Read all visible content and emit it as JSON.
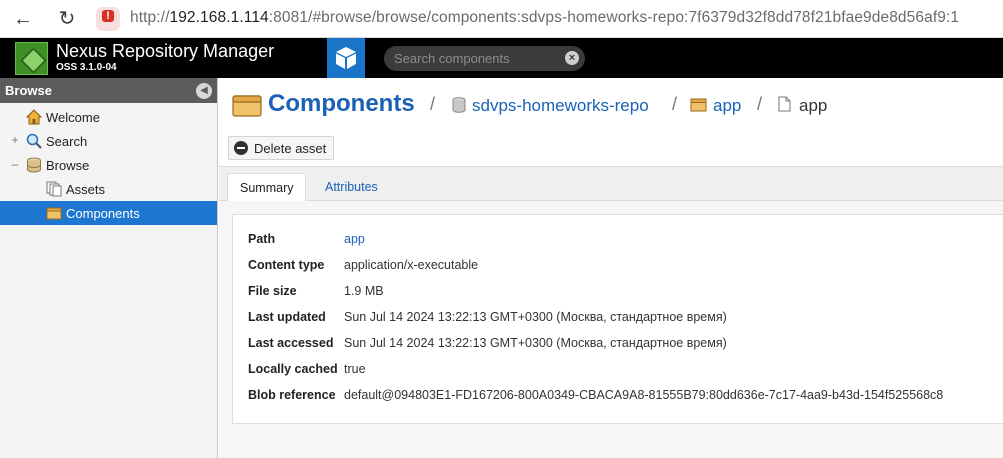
{
  "browser": {
    "url_prefix": "http://",
    "url_host": "192.168.1.114",
    "url_rest": ":8081/#browse/browse/components:sdvps-homeworks-repo:7f6379d32f8dd78f21bfae9de8d56af9:1"
  },
  "app": {
    "title": "Nexus Repository Manager",
    "version": "OSS 3.1.0-04",
    "search_placeholder": "Search components"
  },
  "sidebar": {
    "header": "Browse",
    "items": [
      {
        "label": "Welcome",
        "icon": "home-icon"
      },
      {
        "label": "Search",
        "icon": "search-icon"
      },
      {
        "label": "Browse",
        "icon": "database-icon"
      },
      {
        "label": "Assets",
        "icon": "assets-icon"
      },
      {
        "label": "Components",
        "icon": "box-icon"
      }
    ]
  },
  "breadcrumb": {
    "title": "Components",
    "separator": "/",
    "repo": "sdvps-homeworks-repo",
    "group": "app",
    "asset": "app"
  },
  "toolbar": {
    "delete_label": "Delete asset"
  },
  "tabs": {
    "summary": "Summary",
    "attributes": "Attributes"
  },
  "properties": [
    {
      "key": "Path",
      "value": "app"
    },
    {
      "key": "Content type",
      "value": "application/x-executable"
    },
    {
      "key": "File size",
      "value": "1.9 MB"
    },
    {
      "key": "Last updated",
      "value": "Sun Jul 14 2024 13:22:13 GMT+0300 (Москва, стандартное время)"
    },
    {
      "key": "Last accessed",
      "value": "Sun Jul 14 2024 13:22:13 GMT+0300 (Москва, стандартное время)"
    },
    {
      "key": "Locally cached",
      "value": "true"
    },
    {
      "key": "Blob reference",
      "value": "default@094803E1-FD167206-800A0349-CBACA9A8-81555B79:80dd636e-7c17-4aa9-b43d-154f525568c8"
    }
  ]
}
